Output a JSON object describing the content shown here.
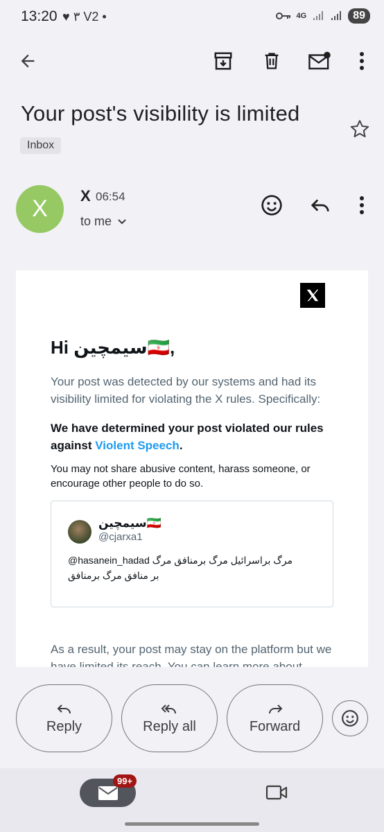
{
  "status_bar": {
    "time": "13:20",
    "extra": "♥ ۳ V2 •",
    "network": "4G",
    "battery": "89"
  },
  "email": {
    "subject": "Your post's visibility is limited",
    "label": "Inbox",
    "avatar_letter": "X",
    "sender": "X",
    "time": "06:54",
    "recipient": "to me"
  },
  "body": {
    "greeting": "Hi سیمچین🇮🇷,",
    "paragraph1": "Your post was detected by our systems and had its visibility limited for violating the X rules. Specifically:",
    "paragraph2_prefix": "We have determined your post violated our rules against ",
    "paragraph2_link": "Violent Speech",
    "paragraph2_suffix": ".",
    "paragraph3": "You may not share abusive content, harass someone, or encourage other people to do so.",
    "tweet": {
      "name": "سیمچین🇮🇷",
      "handle": "@cjarxa1",
      "text": "@hasanein_hadad مرگ براسرائیل مرگ برمنافق مرگ بر منافق مرگ برمنافق"
    },
    "paragraph4": "As a result, your post may stay on the platform but we have limited its reach. You can learn more about"
  },
  "actions": {
    "reply": "Reply",
    "reply_all": "Reply all",
    "forward": "Forward"
  },
  "bottom_nav": {
    "mail_badge": "99+"
  }
}
